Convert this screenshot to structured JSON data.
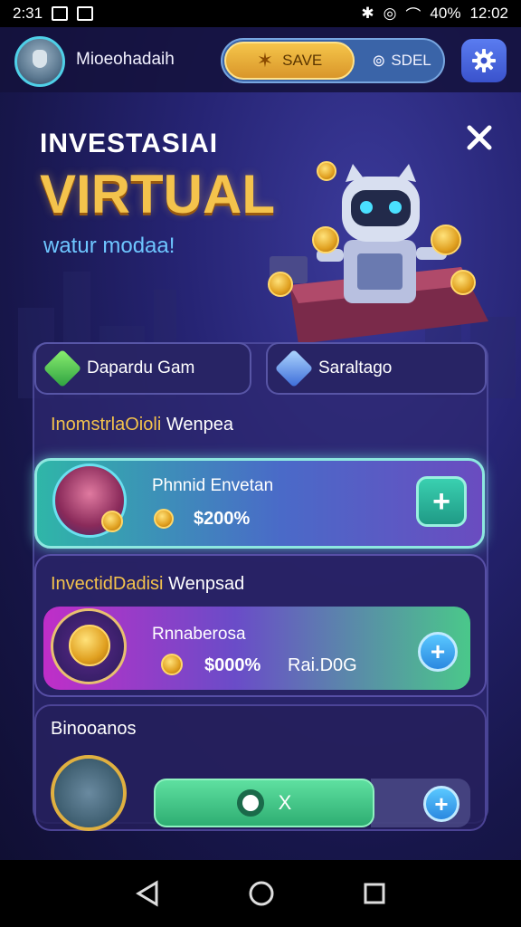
{
  "status_bar": {
    "time_left": "2:31",
    "battery": "40%",
    "time_right": "12:02"
  },
  "header": {
    "username": "Mioeohadaih",
    "toggle_save_label": "SAVE",
    "toggle_sell_label": "SDEL"
  },
  "hero": {
    "title_line1": "INVESTASIAI",
    "title_line2": "VIRTUAL",
    "subtitle": "watur modaa!"
  },
  "tabs": [
    {
      "label": "Dapardu Gam"
    },
    {
      "label": "Saraltago"
    }
  ],
  "sections": [
    {
      "title_highlight": "InomstrlaOioli",
      "title_rest": "Wenpea"
    },
    {
      "title_highlight": "InvectidDadisi",
      "title_rest": "Wenpsad"
    },
    {
      "title": "Binooanos"
    }
  ],
  "cards": [
    {
      "title": "Phnnid Envetan",
      "value": "$200%"
    },
    {
      "title": "Rnnaberosa",
      "value": "$000%",
      "value2": "Rai.D0G"
    }
  ],
  "green_bar_label": "X",
  "colors": {
    "accent_gold": "#f4c34c",
    "accent_teal": "#2fb6a8",
    "accent_magenta": "#c02ec8"
  }
}
